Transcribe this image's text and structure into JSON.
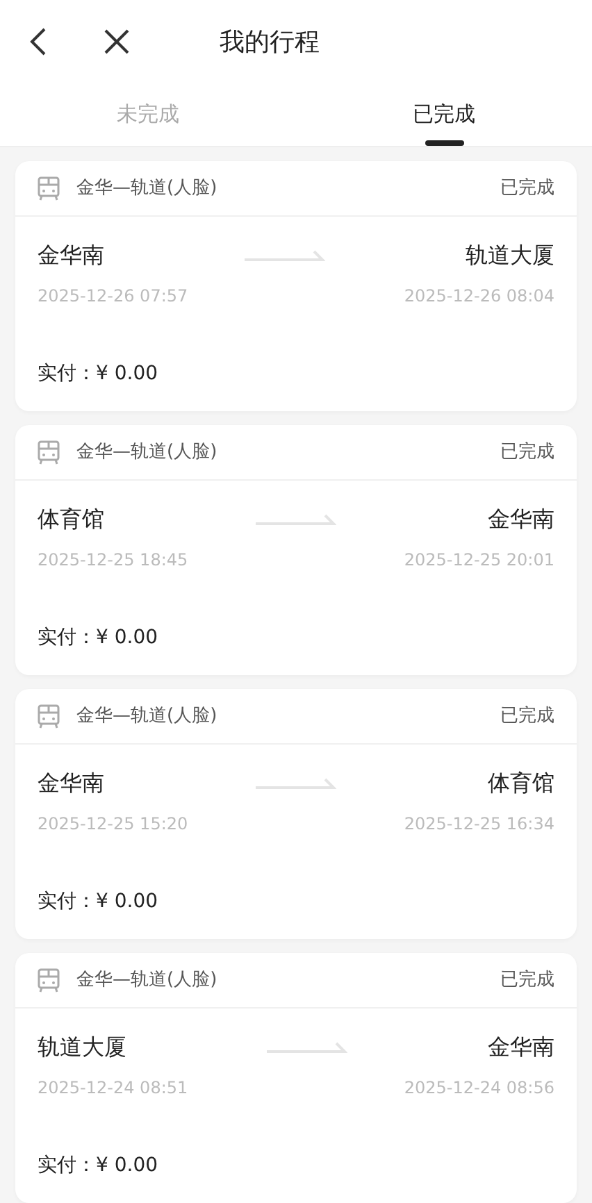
{
  "header": {
    "title": "我的行程"
  },
  "tabs": [
    {
      "label": "未完成",
      "selected": false
    },
    {
      "label": "已完成",
      "selected": true
    }
  ],
  "trips": [
    {
      "line": "金华—轨道(人脸)",
      "status": "已完成",
      "from": "金华南",
      "from_time": "2025-12-26 07:57",
      "to": "轨道大厦",
      "to_time": "2025-12-26 08:04",
      "fare": "实付：¥ 0.00"
    },
    {
      "line": "金华—轨道(人脸)",
      "status": "已完成",
      "from": "体育馆",
      "from_time": "2025-12-25 18:45",
      "to": "金华南",
      "to_time": "2025-12-25 20:01",
      "fare": "实付：¥ 0.00"
    },
    {
      "line": "金华—轨道(人脸)",
      "status": "已完成",
      "from": "金华南",
      "from_time": "2025-12-25 15:20",
      "to": "体育馆",
      "to_time": "2025-12-25 16:34",
      "fare": "实付：¥ 0.00"
    },
    {
      "line": "金华—轨道(人脸)",
      "status": "已完成",
      "from": "轨道大厦",
      "from_time": "2025-12-24 08:51",
      "to": "金华南",
      "to_time": "2025-12-24 08:56",
      "fare": "实付：¥ 0.00"
    }
  ]
}
